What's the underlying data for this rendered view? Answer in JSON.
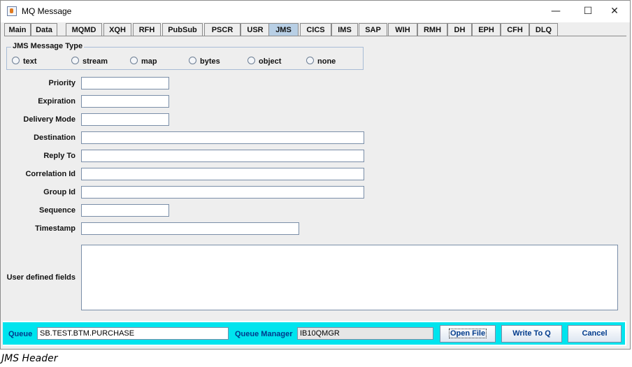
{
  "window": {
    "title": "MQ Message",
    "controls": {
      "minimize": "—",
      "maximize": "☐",
      "close": "✕"
    }
  },
  "tabs": [
    {
      "label": "Main",
      "active": false
    },
    {
      "label": "Data",
      "active": false
    },
    {
      "label": "MQMD",
      "active": false
    },
    {
      "label": "XQH",
      "active": false
    },
    {
      "label": "RFH",
      "active": false
    },
    {
      "label": "PubSub",
      "active": false
    },
    {
      "label": "PSCR",
      "active": false
    },
    {
      "label": "USR",
      "active": false
    },
    {
      "label": "JMS",
      "active": true
    },
    {
      "label": "CICS",
      "active": false
    },
    {
      "label": "IMS",
      "active": false
    },
    {
      "label": "SAP",
      "active": false
    },
    {
      "label": "WIH",
      "active": false
    },
    {
      "label": "RMH",
      "active": false
    },
    {
      "label": "DH",
      "active": false
    },
    {
      "label": "EPH",
      "active": false
    },
    {
      "label": "CFH",
      "active": false
    },
    {
      "label": "DLQ",
      "active": false
    }
  ],
  "jms_type": {
    "title": "JMS Message Type",
    "options": [
      "text",
      "stream",
      "map",
      "bytes",
      "object",
      "none"
    ],
    "selected": ""
  },
  "fields": [
    {
      "label": "Priority",
      "value": ""
    },
    {
      "label": "Expiration",
      "value": ""
    },
    {
      "label": "Delivery Mode",
      "value": ""
    },
    {
      "label": "Destination",
      "value": ""
    },
    {
      "label": "Reply To",
      "value": ""
    },
    {
      "label": "Correlation Id",
      "value": ""
    },
    {
      "label": "Group Id",
      "value": ""
    },
    {
      "label": "Sequence",
      "value": ""
    },
    {
      "label": "Timestamp",
      "value": ""
    }
  ],
  "user_defined": {
    "label": "User defined fields",
    "value": ""
  },
  "footer": {
    "queue_label": "Queue",
    "queue_value": "SB.TEST.BTM.PURCHASE",
    "qmgr_label": "Queue Manager",
    "qmgr_value": "IB10QMGR",
    "open_file": "Open File",
    "write_to_q": "Write To Q",
    "cancel": "Cancel"
  },
  "caption": "JMS Header",
  "colors": {
    "active_tab": "#b8cfe5",
    "footer_bg": "#00e4ee",
    "label_blue": "#003b8c"
  }
}
